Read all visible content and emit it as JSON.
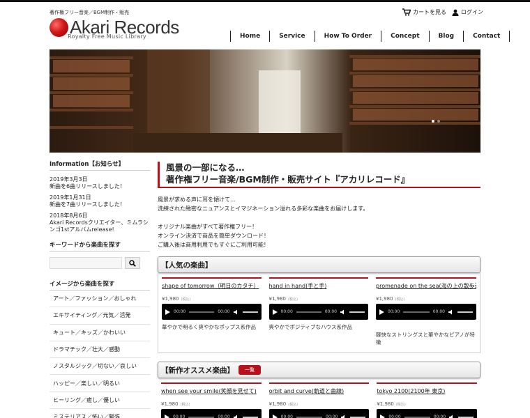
{
  "header": {
    "tagline": "著作権フリー音楽／BGM制作・販売",
    "logo_text": "Akari Records",
    "logo_sub": "Royalty Free Music Library",
    "cart_label": "カートを見る",
    "login_label": "ログイン"
  },
  "nav": [
    "Home",
    "Service",
    "How To Order",
    "Concept",
    "Blog",
    "Contact"
  ],
  "sidebar": {
    "info_title": "Information【お知らせ】",
    "news": [
      {
        "date": "2019年3月3日",
        "text": "新曲を6曲リリースしました！"
      },
      {
        "date": "2019年1月31日",
        "text": "新曲を7曲リリースしました！"
      },
      {
        "date": "2018年8月6日",
        "text": "Akari Recordsクリエイター、ミムラシンゴ1stアルバムrelease!"
      }
    ],
    "search_title": "キーワードから楽曲を探す",
    "image_title": "イメージから楽曲を探す",
    "categories": [
      "アート／ファッション／おしゃれ",
      "エキサイティング／元気／活発",
      "キュート／キッズ／かわいい",
      "ドラマチック／壮大／感動",
      "ノスタルジック／切ない／哀しい",
      "ハッピー／楽しい／明るい",
      "ヒーリング／癒し／優しい",
      "ミステリアス／怖い／緊張"
    ]
  },
  "main": {
    "title_line1": "風景の一部になる…",
    "title_line2": "著作権フリー音楽/BGM制作・販売サイト『アカリレコード』",
    "intro": [
      "風景が求める声に耳を傾けて…",
      "洗練された緻密なニュアンスとイマジネーション溢れる多彩な楽曲をお届けします。",
      "",
      "オリジナル楽曲がすべて著作権フリー！",
      "オンライン決済で商品を簡単ダウンロード！",
      "ご購入後は商用利用でもすぐにご利用可能！"
    ],
    "popular_title": "【人気の楽曲】",
    "new_title": "【新作オススメ楽曲】",
    "new_badge": "一覧",
    "price": "¥1,980",
    "tax": "(税込)",
    "time": "00:00",
    "popular": [
      {
        "title": "shape of tomorrow（明日のカタチ）",
        "desc": "華やかで明るく爽やかなポップス系作品"
      },
      {
        "title": "hand in hand(手と手)",
        "desc": "爽やかでポジティブなハウス系作品"
      },
      {
        "title": "promenade on the sea(海の上の散歩道)",
        "desc": "軽快なストリングスと華やかなピアノが特徴"
      }
    ],
    "new_songs": [
      {
        "title": "when see your smile(笑顔を見せて)"
      },
      {
        "title": "orbit and curve(軌道と曲線)"
      },
      {
        "title": "tokyo 2100(2100年 東京)"
      }
    ]
  }
}
